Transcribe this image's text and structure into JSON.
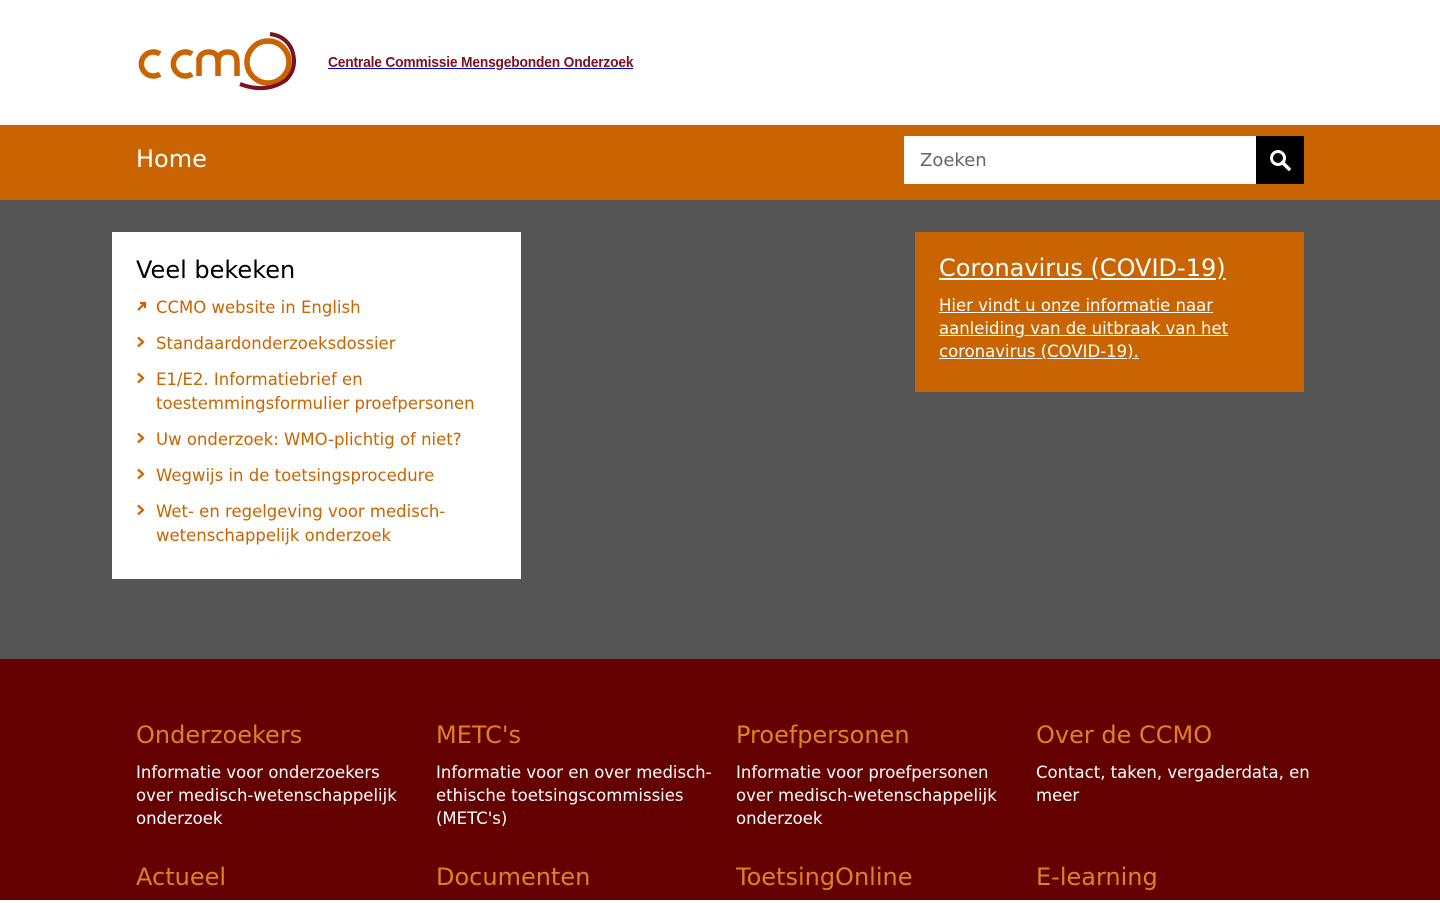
{
  "brand": {
    "logo_text": "ccmo",
    "tagline": "Centrale Commissie Mensgebonden Onderzoek",
    "colors": {
      "orange": "#c96400",
      "maroon": "#650000",
      "gray": "#555555",
      "logo_red": "#7a1020"
    }
  },
  "nav": {
    "home_label": "Home"
  },
  "search": {
    "placeholder": "Zoeken",
    "icon": "search-icon"
  },
  "popular": {
    "title": "Veel bekeken",
    "items": [
      {
        "label": "CCMO website in English",
        "icon": "external-arrow-icon"
      },
      {
        "label": "Standaardonderzoeksdossier",
        "icon": "chevron-right-icon"
      },
      {
        "label": "E1/E2. Informatiebrief en toestemmingsformulier proefpersonen",
        "icon": "chevron-right-icon"
      },
      {
        "label": "Uw onderzoek: WMO-plichtig of niet?",
        "icon": "chevron-right-icon"
      },
      {
        "label": "Wegwijs in de toetsingsprocedure",
        "icon": "chevron-right-icon"
      },
      {
        "label": "Wet- en regelgeving voor medisch-wetenschappelijk onderzoek",
        "icon": "chevron-right-icon"
      }
    ]
  },
  "covid": {
    "title": "Coronavirus (COVID-19)",
    "text": "Hier vindt u onze informatie naar aanleiding van de uitbraak van het coronavirus (COVID-19)."
  },
  "footer": {
    "columns": [
      {
        "title": "Onderzoekers",
        "text": "Informatie voor onderzoekers over medisch-wetenschappelijk onderzoek"
      },
      {
        "title": "METC's",
        "text": "Informatie voor en over medisch-ethische toetsingscommissies (METC's)"
      },
      {
        "title": "Proefpersonen",
        "text": "Informatie voor proefpersonen over medisch-wetenschappelijk onderzoek"
      },
      {
        "title": "Over de CCMO",
        "text": "Contact, taken, vergaderdata, en meer"
      },
      {
        "title": "Actueel",
        "text": ""
      },
      {
        "title": "Documenten",
        "text": ""
      },
      {
        "title": "ToetsingOnline",
        "text": ""
      },
      {
        "title": "E-learning",
        "text": ""
      }
    ]
  }
}
